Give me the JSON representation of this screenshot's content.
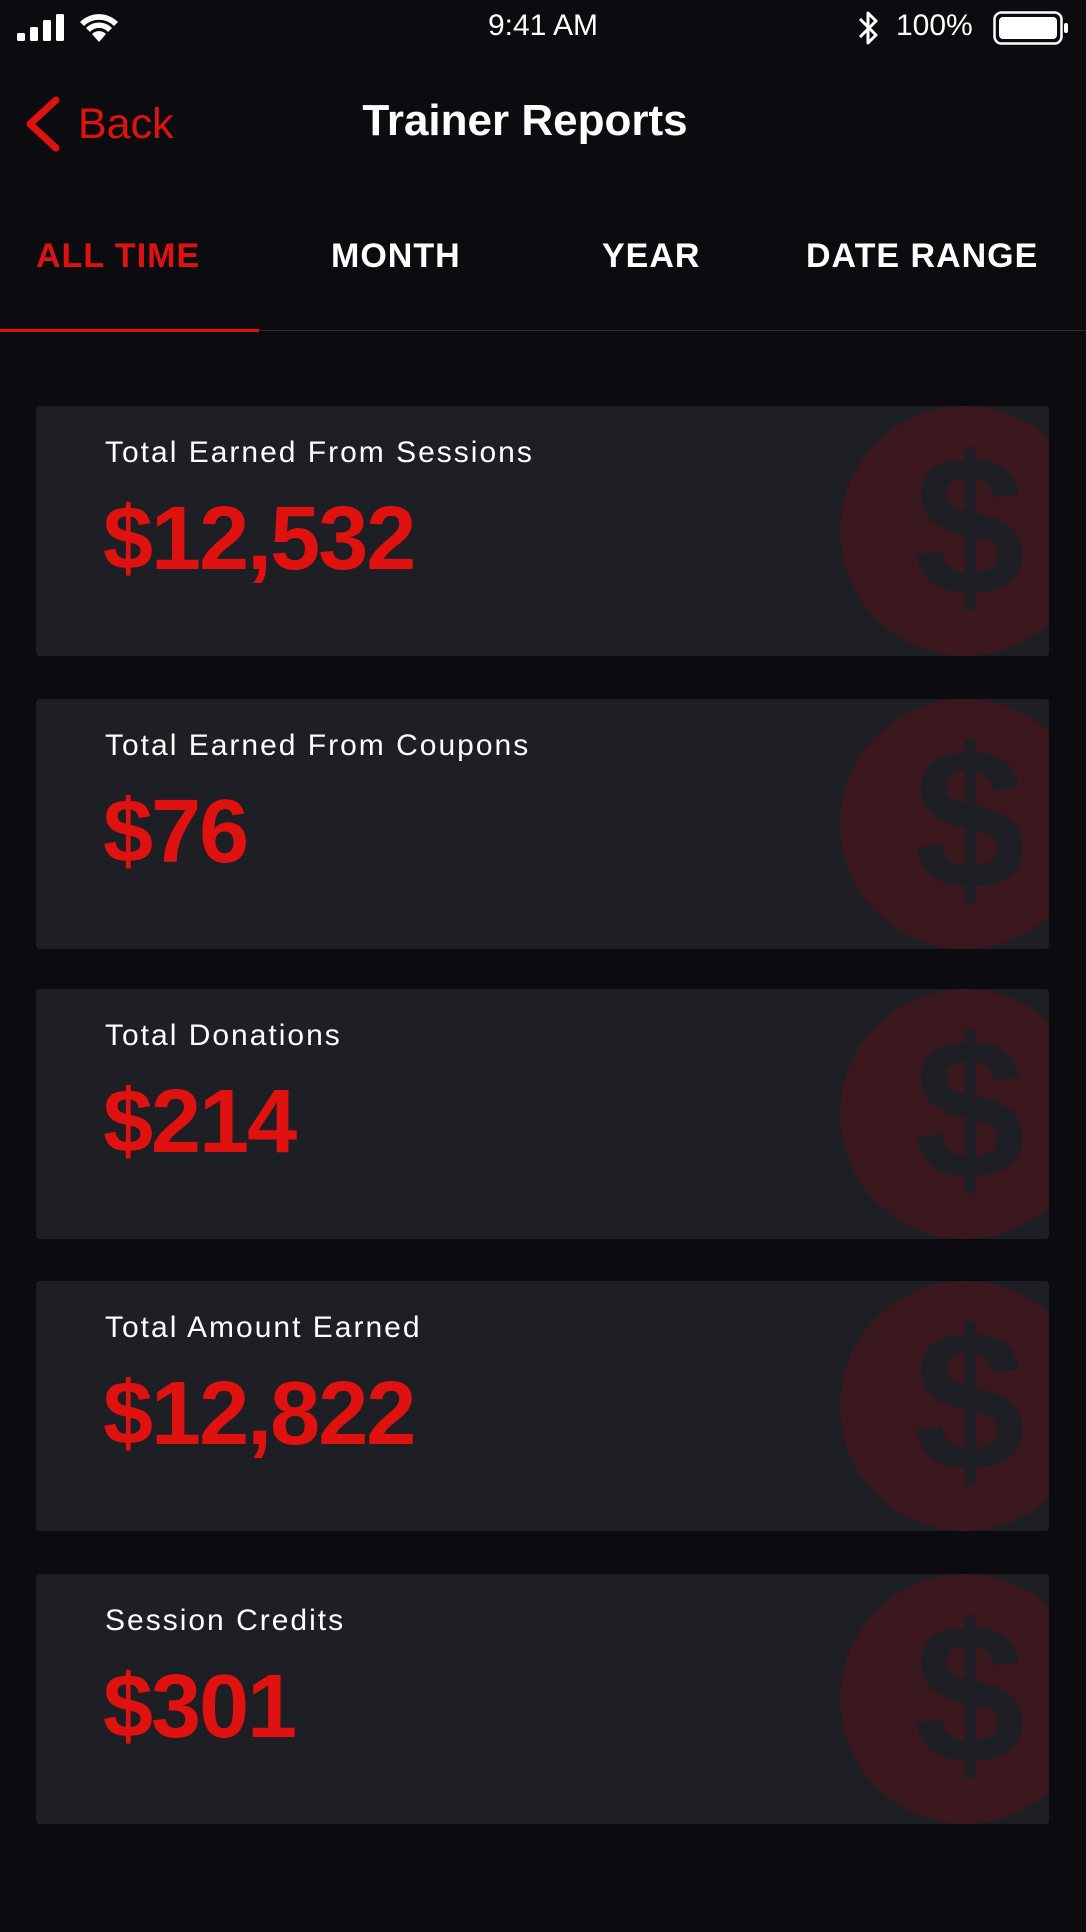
{
  "status_bar": {
    "time": "9:41 AM",
    "battery_percent": "100%",
    "signal_icon": "cellular-signal-icon",
    "wifi_icon": "wifi-icon",
    "bluetooth_icon": "bluetooth-icon",
    "battery_icon": "battery-full-icon"
  },
  "nav": {
    "back_label": "Back",
    "title": "Trainer Reports"
  },
  "tabs": [
    {
      "label": "ALL TIME",
      "active": true
    },
    {
      "label": "MONTH",
      "active": false
    },
    {
      "label": "YEAR",
      "active": false
    },
    {
      "label": "DATE RANGE",
      "active": false
    }
  ],
  "cards": [
    {
      "label": "Total Earned From Sessions",
      "value": "$12,532",
      "icon": "dollar-icon"
    },
    {
      "label": "Total Earned From Coupons",
      "value": "$76",
      "icon": "dollar-icon"
    },
    {
      "label": "Total Donations",
      "value": "$214",
      "icon": "dollar-icon"
    },
    {
      "label": "Total Amount Earned",
      "value": "$12,822",
      "icon": "dollar-icon"
    },
    {
      "label": "Session Credits",
      "value": "$301",
      "icon": "dollar-icon"
    }
  ],
  "colors": {
    "background": "#0c0c10",
    "card": "#1e1e25",
    "accent": "#e0120f",
    "icon_circle": "#3a181d"
  }
}
